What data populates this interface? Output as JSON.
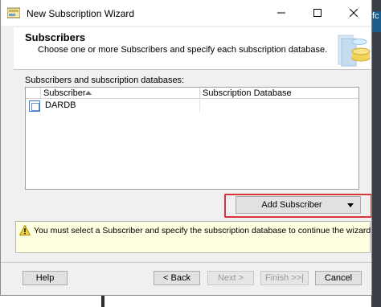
{
  "window": {
    "title": "New Subscription Wizard",
    "controls": {
      "minimize_icon": "minimize-icon",
      "maximize_icon": "maximize-icon",
      "close_icon": "close-icon"
    }
  },
  "header": {
    "title": "Subscribers",
    "description": "Choose one or more Subscribers and specify each subscription database."
  },
  "main": {
    "list_label": "Subscribers and subscription databases:",
    "columns": [
      "Subscriber",
      "Subscription Database"
    ],
    "sort_indicator": "sort-ascending-icon",
    "rows": [
      {
        "checked": false,
        "subscriber": "DARDB",
        "database": ""
      }
    ]
  },
  "add_subscriber": {
    "label": "Add Subscriber",
    "highlight_color": "#d9343a"
  },
  "message": {
    "icon": "warning-icon",
    "text": "You must select a Subscriber and specify the subscription database to continue the wizard."
  },
  "footer": {
    "help": "Help",
    "back": "< Back",
    "next": "Next >",
    "finish": "Finish >>|",
    "cancel": "Cancel"
  },
  "background": {
    "right_fragment": "fc"
  }
}
